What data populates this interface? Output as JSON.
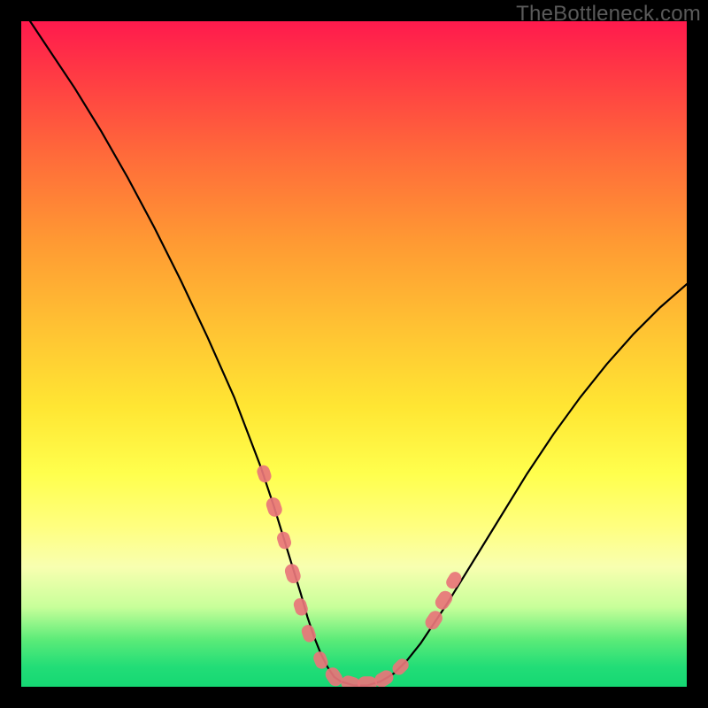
{
  "watermark": "TheBottleneck.com",
  "chart_data": {
    "type": "line",
    "title": "",
    "xlabel": "",
    "ylabel": "",
    "xlim": [
      0,
      100
    ],
    "ylim": [
      0,
      100
    ],
    "grid": false,
    "legend": false,
    "series": [
      {
        "name": "curve",
        "x": [
          0,
          4,
          8,
          12,
          16,
          20,
          24,
          28,
          32,
          36,
          38,
          40,
          42,
          43,
          44,
          45,
          46,
          47,
          48,
          50,
          52,
          54,
          56,
          58,
          60,
          64,
          68,
          72,
          76,
          80,
          84,
          88,
          92,
          96,
          100
        ],
        "y": [
          102,
          96,
          90,
          83.5,
          76.5,
          69,
          61,
          52.5,
          43.5,
          33,
          27,
          20.5,
          14,
          10.5,
          7.5,
          5,
          3,
          1.5,
          0.8,
          0.2,
          0.2,
          0.8,
          2,
          4,
          6.5,
          12.5,
          19,
          25.5,
          32,
          38,
          43.5,
          48.5,
          53,
          57,
          60.5
        ]
      }
    ],
    "markers": [
      {
        "x": 36.5,
        "y": 32,
        "r": 9
      },
      {
        "x": 38.0,
        "y": 27,
        "r": 10
      },
      {
        "x": 39.5,
        "y": 22,
        "r": 9
      },
      {
        "x": 40.8,
        "y": 17,
        "r": 10
      },
      {
        "x": 42.0,
        "y": 12,
        "r": 9
      },
      {
        "x": 43.2,
        "y": 8,
        "r": 9
      },
      {
        "x": 45.0,
        "y": 4,
        "r": 9
      },
      {
        "x": 47.0,
        "y": 1.5,
        "r": 10
      },
      {
        "x": 49.5,
        "y": 0.5,
        "r": 10
      },
      {
        "x": 52.0,
        "y": 0.5,
        "r": 10
      },
      {
        "x": 54.5,
        "y": 1.2,
        "r": 10
      },
      {
        "x": 57.0,
        "y": 3.0,
        "r": 9
      },
      {
        "x": 62.0,
        "y": 10.0,
        "r": 10
      },
      {
        "x": 63.5,
        "y": 13.0,
        "r": 10
      },
      {
        "x": 65.0,
        "y": 16.0,
        "r": 9
      }
    ],
    "marker_color": "#e8757a",
    "curve_color": "#000000"
  }
}
